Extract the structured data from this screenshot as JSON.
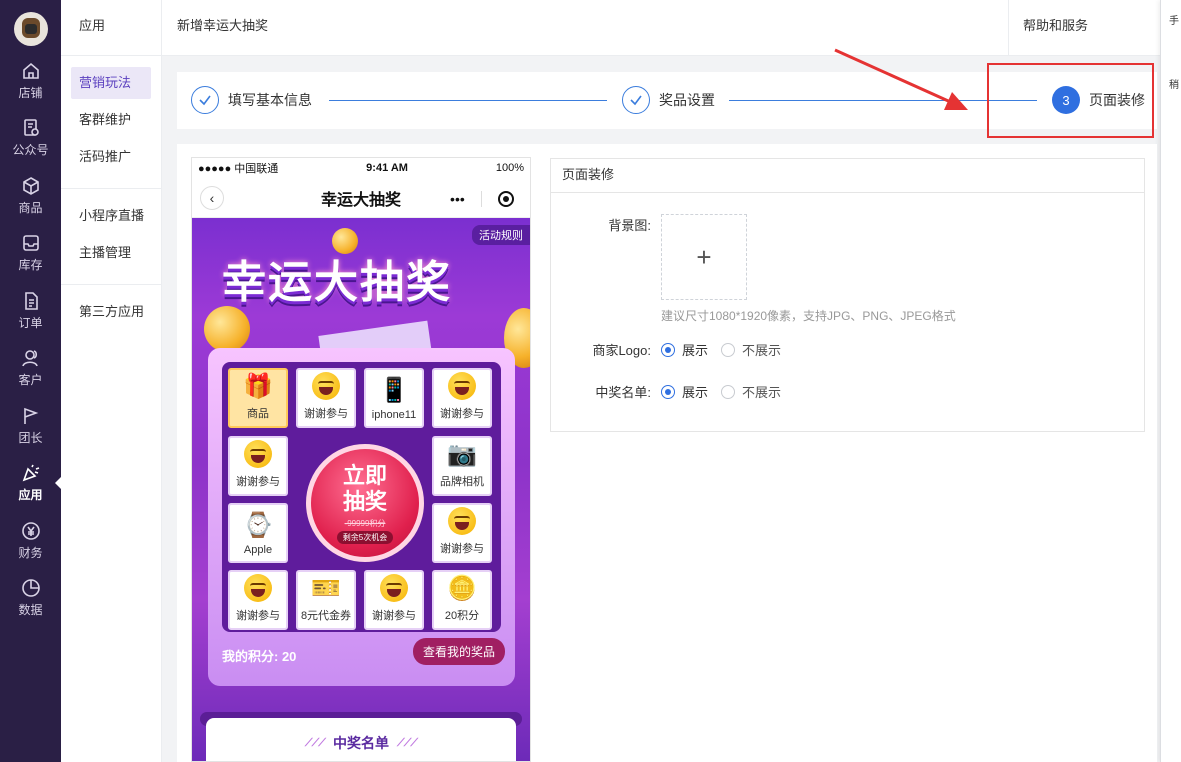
{
  "nav": {
    "items": [
      {
        "label": "店铺",
        "icon": "home-icon"
      },
      {
        "label": "公众号",
        "icon": "document-gear-icon"
      },
      {
        "label": "商品",
        "icon": "cube-icon"
      },
      {
        "label": "库存",
        "icon": "inbox-icon"
      },
      {
        "label": "订单",
        "icon": "file-list-icon"
      },
      {
        "label": "客户",
        "icon": "users-icon"
      },
      {
        "label": "团长",
        "icon": "flag-icon"
      },
      {
        "label": "应用",
        "icon": "party-popper-icon"
      },
      {
        "label": "财务",
        "icon": "yen-icon"
      },
      {
        "label": "数据",
        "icon": "pie-chart-icon"
      }
    ],
    "active": "应用"
  },
  "subnav": {
    "title": "应用",
    "group1": [
      "营销玩法",
      "客群维护",
      "活码推广"
    ],
    "group2": [
      "小程序直播",
      "主播管理"
    ],
    "group3": [
      "第三方应用"
    ],
    "active": "营销玩法"
  },
  "header": {
    "breadcrumb": "新增幸运大抽奖",
    "help": "帮助和服务"
  },
  "rightedge": {
    "a": "手",
    "b": "稍"
  },
  "steps": [
    {
      "label": "填写基本信息",
      "state": "done"
    },
    {
      "label": "奖品设置",
      "state": "done"
    },
    {
      "label": "页面装修",
      "state": "current",
      "number": "3"
    }
  ],
  "phone": {
    "status": {
      "carrier": "●●●●● 中国联通",
      "time": "9:41 AM",
      "battery": "100%"
    },
    "title": "幸运大抽奖",
    "rules": "活动规则",
    "banner_title": "幸运大抽奖",
    "prizes": [
      "商品",
      "谢谢参与",
      "iphone11",
      "谢谢参与",
      "品牌相机",
      "谢谢参与",
      "20积分",
      "谢谢参与",
      "8元代金券",
      "谢谢参与",
      "Apple",
      "谢谢参与"
    ],
    "draw": {
      "line1": "立即",
      "line2": "抽奖",
      "points": "-99999积分",
      "chance": "剩余5次机会"
    },
    "my_points": "我的积分: 20",
    "my_prize": "查看我的奖品",
    "winners": "中奖名单"
  },
  "panel": {
    "title": "页面装修",
    "bg_label": "背景图:",
    "bg_hint": "建议尺寸1080*1920像素，支持JPG、PNG、JPEG格式",
    "logo_label": "商家Logo:",
    "winners_label": "中奖名单:",
    "opt_show": "展示",
    "opt_hide": "不展示"
  },
  "accent": "#2f6fe0",
  "nav_bg": "#2a1f45",
  "annotation_color": "#e53333"
}
